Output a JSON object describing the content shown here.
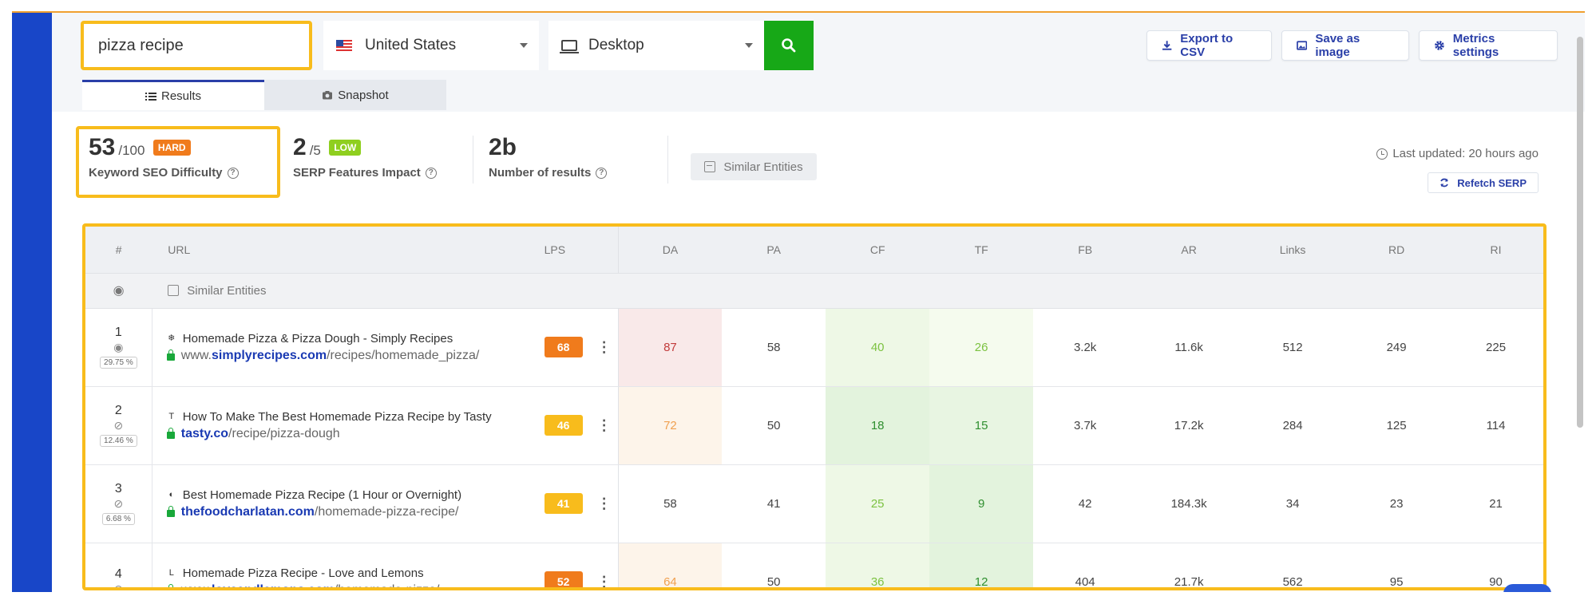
{
  "search": {
    "query": "pizza recipe"
  },
  "location": {
    "selected": "United States",
    "flag": "us-flag"
  },
  "device": {
    "selected": "Desktop",
    "icon": "monitor-icon"
  },
  "toolbar": {
    "export_label": "Export to CSV",
    "save_image_label": "Save as image",
    "metrics_settings_label": "Metrics settings"
  },
  "tabs": [
    {
      "label": "Results",
      "icon": "list-icon",
      "active": true
    },
    {
      "label": "Snapshot",
      "icon": "camera-icon",
      "active": false
    }
  ],
  "metrics": {
    "difficulty": {
      "value": "53",
      "scale": "/100",
      "badge": "HARD",
      "badge_color": "#f07b1c",
      "label": "Keyword SEO Difficulty"
    },
    "serp_impact": {
      "value": "2",
      "scale": "/5",
      "badge": "LOW",
      "badge_color": "#8fcf1f",
      "label": "SERP Features Impact"
    },
    "results": {
      "value": "2b",
      "label": "Number of results"
    },
    "similar_entities_label": "Similar Entities",
    "last_updated": "Last updated: 20 hours ago",
    "refetch_label": "Refetch SERP"
  },
  "table": {
    "headers": [
      "#",
      "URL",
      "LPS",
      "DA",
      "PA",
      "CF",
      "TF",
      "FB",
      "AR",
      "Links",
      "RD",
      "RI"
    ],
    "similar_entities_row": "Similar Entities",
    "rows": [
      {
        "rank": "1",
        "pct": "29.75 %",
        "visible": true,
        "favicon": "❄",
        "title": "Homemade Pizza & Pizza Dough - Simply Recipes",
        "url_prefix": "www.",
        "domain": "simplyrecipes.com",
        "path": "/recipes/homemade_pizza/",
        "lps": "68",
        "lps_color": "#f07b1c",
        "da": "87",
        "pa": "58",
        "cf": "40",
        "tf": "26",
        "fb": "3.2k",
        "ar": "11.6k",
        "links": "512",
        "rd": "249",
        "ri": "225",
        "da_bg": "#f9e9e9",
        "da_color": "#c23b3b",
        "cf_bg": "#eef8e6",
        "cf_color": "#7cc241",
        "tf_bg": "#f5fbee",
        "tf_color": "#7cc241"
      },
      {
        "rank": "2",
        "pct": "12.46 %",
        "visible": false,
        "favicon": "T",
        "title": "How To Make The Best Homemade Pizza Recipe by Tasty",
        "url_prefix": "",
        "domain": "tasty.co",
        "path": "/recipe/pizza-dough",
        "lps": "46",
        "lps_color": "#f8bc1c",
        "da": "72",
        "pa": "50",
        "cf": "18",
        "tf": "15",
        "fb": "3.7k",
        "ar": "17.2k",
        "links": "284",
        "rd": "125",
        "ri": "114",
        "da_bg": "#fdf4ea",
        "da_color": "#f0a050",
        "cf_bg": "#e3f3dd",
        "cf_color": "#2f8f2f",
        "tf_bg": "#e8f5e2",
        "tf_color": "#2f8f2f"
      },
      {
        "rank": "3",
        "pct": "6.68 %",
        "visible": false,
        "favicon": "◐",
        "title": "Best Homemade Pizza Recipe (1 Hour or Overnight)",
        "url_prefix": "",
        "domain": "thefoodcharlatan.com",
        "path": "/homemade-pizza-recipe/",
        "lps": "41",
        "lps_color": "#f8bc1c",
        "da": "58",
        "pa": "41",
        "cf": "25",
        "tf": "9",
        "fb": "42",
        "ar": "184.3k",
        "links": "34",
        "rd": "23",
        "ri": "21",
        "da_bg": "#ffffff",
        "da_color": "#444444",
        "cf_bg": "#eef8e6",
        "cf_color": "#7cc241",
        "tf_bg": "#e3f3dd",
        "tf_color": "#2f8f2f"
      },
      {
        "rank": "4",
        "pct": "",
        "visible": false,
        "favicon": "L",
        "title": "Homemade Pizza Recipe - Love and Lemons",
        "url_prefix": "www.",
        "domain": "loveandlemons.com",
        "path": "/homemade-pizza/",
        "lps": "52",
        "lps_color": "#f07b1c",
        "da": "64",
        "pa": "50",
        "cf": "36",
        "tf": "12",
        "fb": "404",
        "ar": "21.7k",
        "links": "562",
        "rd": "95",
        "ri": "90",
        "da_bg": "#fdf4ea",
        "da_color": "#f0a050",
        "cf_bg": "#eef8e6",
        "cf_color": "#7cc241",
        "tf_bg": "#e3f3dd",
        "tf_color": "#2f8f2f"
      }
    ]
  },
  "colors": {
    "accent": "#2a3fa8",
    "highlight": "#f8bc1c",
    "go_button": "#17a817",
    "sidebar": "#1846c8"
  }
}
